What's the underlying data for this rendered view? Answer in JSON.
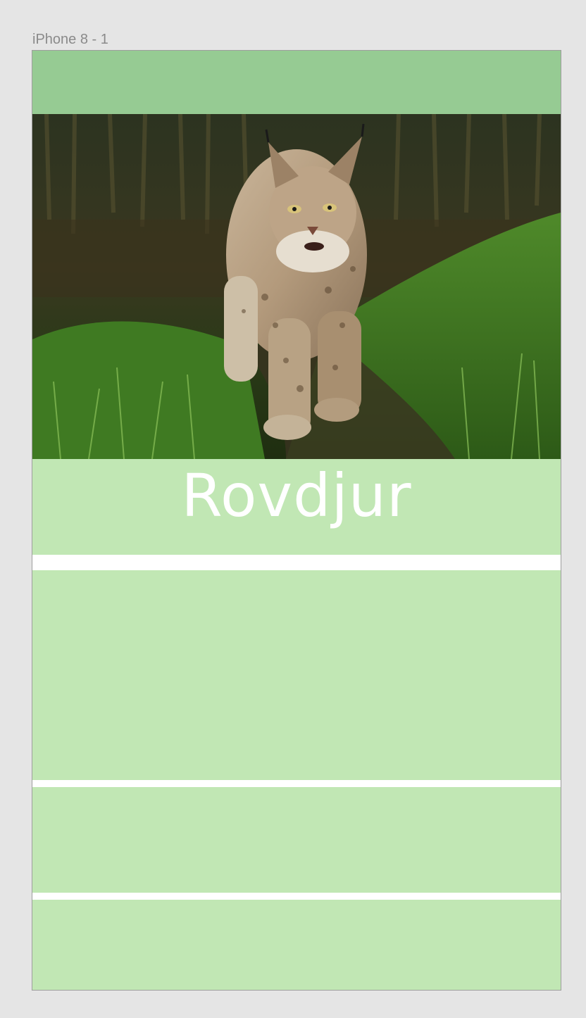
{
  "frame": {
    "label": "iPhone 8 - 1"
  },
  "colors": {
    "canvas": "#e5e5e5",
    "header": "#96cb93",
    "band": "#c1e7b4",
    "divider": "#ffffff",
    "title_text": "#ffffff"
  },
  "hero": {
    "image_subject": "lynx-walking-on-grass-photo"
  },
  "title": {
    "text": "Rovdjur"
  }
}
